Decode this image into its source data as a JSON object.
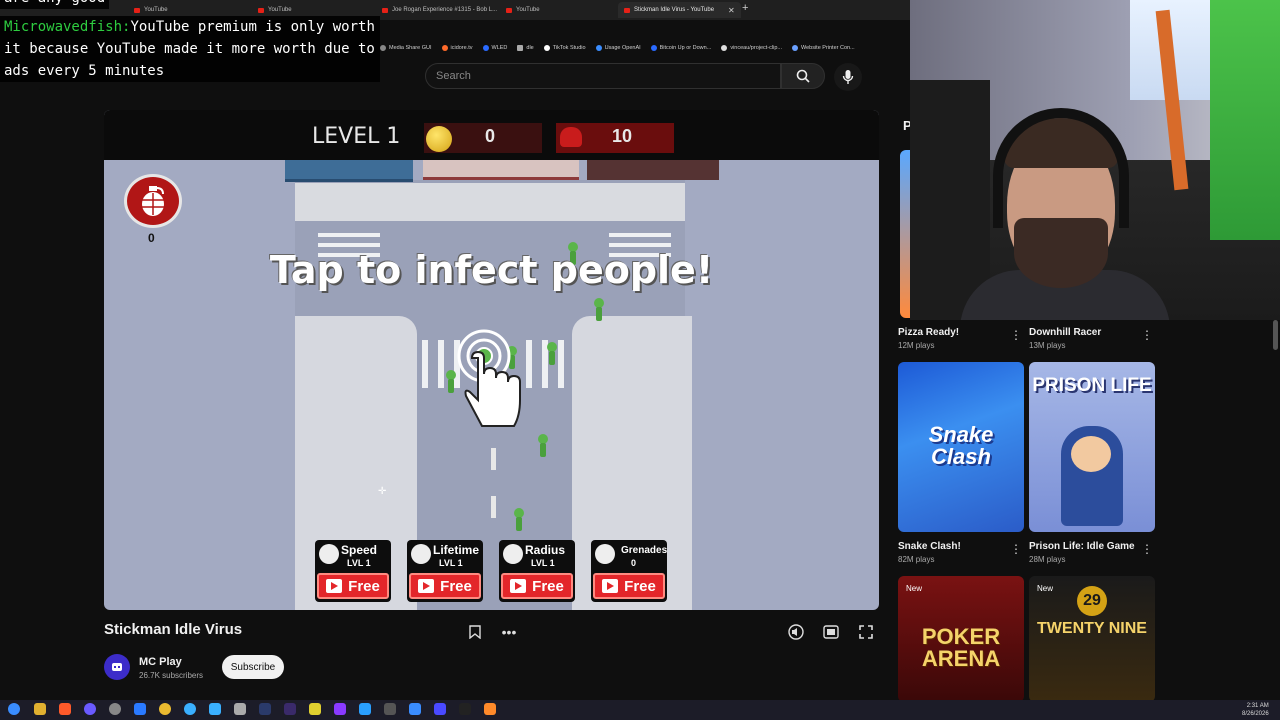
{
  "browser": {
    "tabs": [
      {
        "label": "YouTube"
      },
      {
        "label": "YouTube"
      },
      {
        "label": "Joe Rogan Experience #1315 - Bob L..."
      },
      {
        "label": "YouTube"
      },
      {
        "label": "Stickman Idle Virus - YouTube",
        "active": true
      }
    ],
    "bookmarks": [
      "Media Share GUI",
      "icidore.tv",
      "WLED",
      "dle",
      "TikTok Studio",
      "Usage OpenAI",
      "Bitcoin Up or Down...",
      "vinceau/project-clip...",
      "Website Printer Con..."
    ]
  },
  "chat": {
    "prev_text": "are any good",
    "user": "Microwavedfish:",
    "message": "YouTube premium is only worth it because YouTube made it more worth due to ads every 5 minutes"
  },
  "search": {
    "placeholder": "Search"
  },
  "game": {
    "level_label": "LEVEL 1",
    "coins": "0",
    "kills": "10",
    "grenade_count": "0",
    "tap_text": "Tap to infect people!",
    "upgrades": [
      {
        "title": "Speed",
        "sub": "LVL 1",
        "button": "Free"
      },
      {
        "title": "Lifetime",
        "sub": "LVL 1",
        "button": "Free"
      },
      {
        "title": "Radius",
        "sub": "LVL 1",
        "button": "Free"
      },
      {
        "title": "Grenades",
        "sub": "0",
        "button": "Free"
      }
    ]
  },
  "video": {
    "title": "Stickman Idle Virus",
    "channel": "MC Play",
    "subscribers": "26.7K subscribers",
    "subscribe_label": "Subscribe"
  },
  "sidebar": {
    "label": "P",
    "cards": [
      {
        "name": "Pizza Ready!",
        "plays": "12M plays"
      },
      {
        "name": "Downhill Racer",
        "plays": "13M plays"
      },
      {
        "name": "Snake Clash!",
        "plays": "82M plays",
        "thumb_text": "Snake Clash"
      },
      {
        "name": "Prison Life: Idle Game",
        "plays": "28M plays",
        "thumb_text": "PRISON LIFE"
      },
      {
        "badge": "New",
        "thumb_text": "POKER ARENA"
      },
      {
        "badge": "New",
        "thumb_text": "TWENTY NINE",
        "thumb_num": "29"
      }
    ]
  },
  "taskbar": {
    "time": "2:31 AM",
    "date": "8/26/2026"
  }
}
